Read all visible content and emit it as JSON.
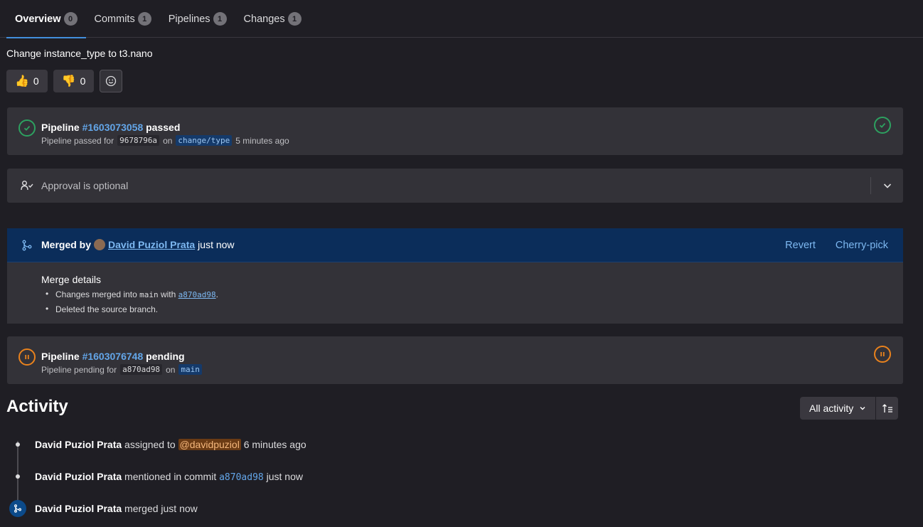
{
  "tabs": [
    {
      "label": "Overview",
      "count": "0"
    },
    {
      "label": "Commits",
      "count": "1"
    },
    {
      "label": "Pipelines",
      "count": "1"
    },
    {
      "label": "Changes",
      "count": "1"
    }
  ],
  "mr_title": "Change instance_type to t3.nano",
  "reactions": {
    "thumbs_up": "0",
    "thumbs_down": "0"
  },
  "pipeline1": {
    "prefix": "Pipeline",
    "id": "#1603073058",
    "status": "passed",
    "sub_prefix": "Pipeline passed for",
    "commit": "9678796a",
    "on": "on",
    "branch": "change/type",
    "time": "5 minutes ago"
  },
  "approval": {
    "text": "Approval is optional"
  },
  "merge": {
    "prefix": "Merged by",
    "user": "David Puziol Prata",
    "time": "just now",
    "revert": "Revert",
    "cherry_pick": "Cherry-pick",
    "details_title": "Merge details",
    "detail1_a": "Changes merged into",
    "detail1_branch": "main",
    "detail1_b": "with",
    "detail1_commit": "a870ad98",
    "detail1_end": ".",
    "detail2": "Deleted the source branch."
  },
  "pipeline2": {
    "prefix": "Pipeline",
    "id": "#1603076748",
    "status": "pending",
    "sub_prefix": "Pipeline pending for",
    "commit": "a870ad98",
    "on": "on",
    "branch": "main"
  },
  "activity": {
    "title": "Activity",
    "filter_label": "All activity",
    "items": [
      {
        "user": "David Puziol Prata",
        "text": "assigned to",
        "mention": "@davidpuziol",
        "time": "6 minutes ago"
      },
      {
        "user": "David Puziol Prata",
        "text": "mentioned in commit",
        "commit": "a870ad98",
        "time": "just now"
      },
      {
        "user": "David Puziol Prata",
        "text": "merged just now"
      }
    ]
  },
  "colors": {
    "success": "#2da160",
    "pending": "#e9821d",
    "link": "#63a6e9",
    "merge_bg": "#0b2d5a"
  }
}
